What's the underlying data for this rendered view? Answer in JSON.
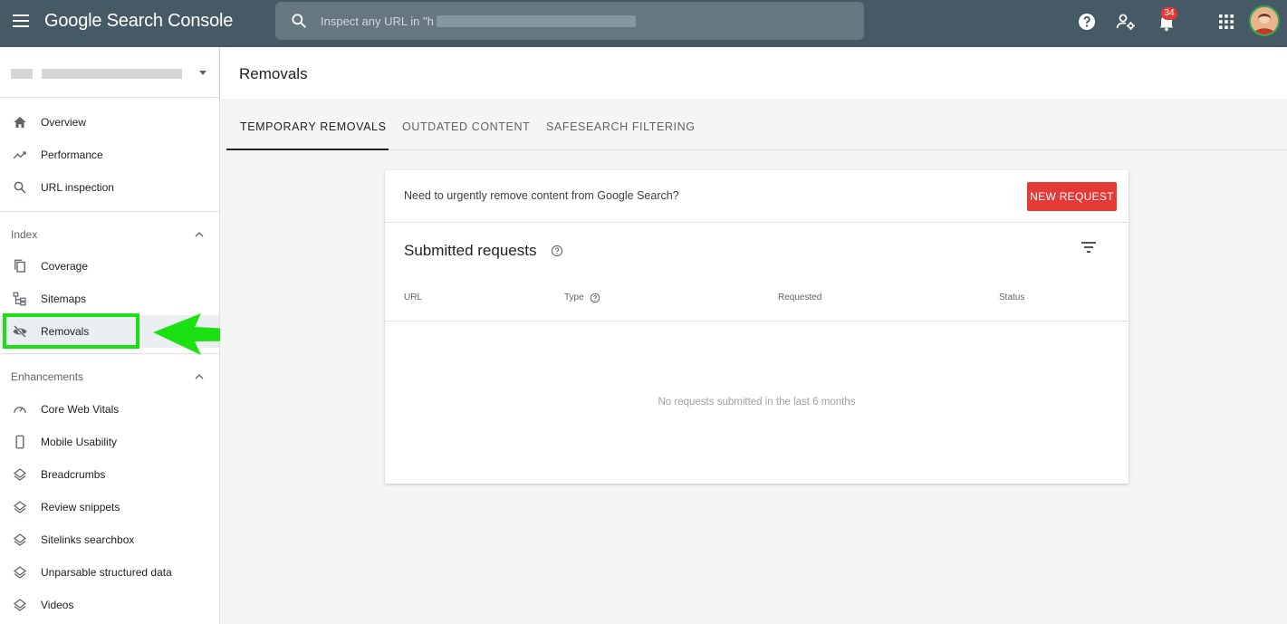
{
  "app": {
    "title": "Google Search Console",
    "search_placeholder": "Inspect any URL in \"h",
    "notification_count": "34"
  },
  "sidebar": {
    "items_top": [
      {
        "label": "Overview",
        "icon": "home-icon"
      },
      {
        "label": "Performance",
        "icon": "trending-up-icon"
      },
      {
        "label": "URL inspection",
        "icon": "search-icon"
      }
    ],
    "index_section": "Index",
    "items_index": [
      {
        "label": "Coverage",
        "icon": "coverage-icon"
      },
      {
        "label": "Sitemaps",
        "icon": "sitemap-icon"
      },
      {
        "label": "Removals",
        "icon": "eye-off-icon",
        "active": true
      }
    ],
    "enhancements_section": "Enhancements",
    "items_enhancements": [
      {
        "label": "Core Web Vitals",
        "icon": "speed-gauge-icon"
      },
      {
        "label": "Mobile Usability",
        "icon": "phone-icon"
      },
      {
        "label": "Breadcrumbs",
        "icon": "layers-icon"
      },
      {
        "label": "Review snippets",
        "icon": "layers-icon"
      },
      {
        "label": "Sitelinks searchbox",
        "icon": "layers-icon"
      },
      {
        "label": "Unparsable structured data",
        "icon": "layers-icon"
      },
      {
        "label": "Videos",
        "icon": "layers-icon"
      }
    ]
  },
  "page": {
    "title": "Removals",
    "tabs": [
      {
        "label": "TEMPORARY REMOVALS",
        "active": true
      },
      {
        "label": "OUTDATED CONTENT"
      },
      {
        "label": "SAFESEARCH FILTERING"
      }
    ]
  },
  "card": {
    "prompt": "Need to urgently remove content from Google Search?",
    "new_request_label": "NEW REQUEST",
    "submitted_title": "Submitted requests",
    "columns": [
      "URL",
      "Type",
      "Requested",
      "Status"
    ],
    "empty_text": "No requests submitted in the last 6 months"
  },
  "colors": {
    "topbar": "#455a64",
    "accent_red": "#e53935",
    "highlight_green": "#1be014"
  }
}
